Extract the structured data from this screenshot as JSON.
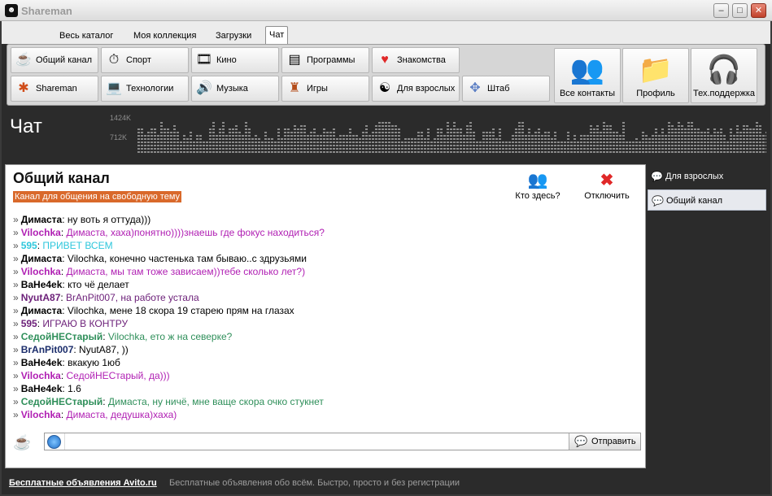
{
  "window": {
    "title": "Shareman",
    "minimize": "–",
    "maximize": "□",
    "close": "✕"
  },
  "tabs": [
    {
      "label": "Весь каталог"
    },
    {
      "label": "Моя коллекция"
    },
    {
      "label": "Загрузки"
    },
    {
      "label": "Чат"
    }
  ],
  "toolbar": {
    "row1": [
      {
        "label": "Общий канал",
        "icon": "cup-icon"
      },
      {
        "label": "Спорт",
        "icon": "stopwatch-icon"
      },
      {
        "label": "Кино",
        "icon": "film-icon"
      },
      {
        "label": "Программы",
        "icon": "programs-icon"
      },
      {
        "label": "Знакомства",
        "icon": "heart-icon"
      }
    ],
    "row2": [
      {
        "label": "Shareman",
        "icon": "shareman-icon"
      },
      {
        "label": "Технологии",
        "icon": "laptop-icon"
      },
      {
        "label": "Музыка",
        "icon": "speaker-icon"
      },
      {
        "label": "Игры",
        "icon": "castle-icon"
      },
      {
        "label": "Для взрослых",
        "icon": "yinyang-icon"
      },
      {
        "label": "Штаб",
        "icon": "compass-icon"
      }
    ],
    "big": [
      {
        "label": "Все контакты",
        "icon": "contacts-icon"
      },
      {
        "label": "Профиль",
        "icon": "profile-folder-icon"
      },
      {
        "label": "Тех.поддержка",
        "icon": "headset-icon"
      }
    ]
  },
  "chat_header": {
    "title": "Чат",
    "scale_top": "1424K",
    "scale_mid": "712K"
  },
  "panel": {
    "title": "Общий канал",
    "subtitle": "Канал для общения на свободную тему",
    "who_here": "Кто здесь?",
    "disconnect": "Отключить"
  },
  "messages": [
    {
      "nick": "Димаста",
      "text": "ну воть я оттуда)))",
      "nick_color": "#000000",
      "text_color": "#000000"
    },
    {
      "nick": "Vilochka",
      "text": "Димаста, хаха)понятно))))знаешь где фокус находиться?",
      "nick_color": "#b01fb3",
      "text_color": "#b01fb3"
    },
    {
      "nick": "595",
      "text": "ПРИВЕТ ВСЕМ",
      "nick_color": "#2ec7dc",
      "text_color": "#2ec7dc"
    },
    {
      "nick": "Димаста",
      "text": "Vilochka, конечно частенька там бываю..с здрузьями",
      "nick_color": "#000000",
      "text_color": "#000000"
    },
    {
      "nick": "Vilochka",
      "text": "Димаста, мы там тоже зависаем))тебе сколько лет?)",
      "nick_color": "#b01fb3",
      "text_color": "#b01fb3"
    },
    {
      "nick": "BaHe4ek",
      "text": "кто чё делает",
      "nick_color": "#000000",
      "text_color": "#000000"
    },
    {
      "nick": "NyutA87",
      "text": "BrAnPit007, на работе устала",
      "nick_color": "#6b1f78",
      "text_color": "#6b1f78"
    },
    {
      "nick": "Димаста",
      "text": "Vilochka, мене 18 скора 19 старею прям на глазах",
      "nick_color": "#000000",
      "text_color": "#000000"
    },
    {
      "nick": "595",
      "text": "ИГРАЮ В КОНТРУ",
      "nick_color": "#6b1f78",
      "text_color": "#6b1f78"
    },
    {
      "nick": "СедойНЕСтарый",
      "text": "Vilochka, ето ж на северке?",
      "nick_color": "#2f8f5a",
      "text_color": "#2f8f5a"
    },
    {
      "nick": "BrAnPit007",
      "text": "NyutA87, ))",
      "nick_color": "#1b2d6b",
      "text_color": "#000000"
    },
    {
      "nick": "BaHe4ek",
      "text": "вкакую 1юб",
      "nick_color": "#000000",
      "text_color": "#000000"
    },
    {
      "nick": "Vilochka",
      "text": "СедойНЕСтарый, да)))",
      "nick_color": "#b01fb3",
      "text_color": "#b01fb3"
    },
    {
      "nick": "BaHe4ek",
      "text": "1.6",
      "nick_color": "#000000",
      "text_color": "#000000"
    },
    {
      "nick": "СедойНЕСтарый",
      "text": "Димаста, ну ничё, мне ваще скора очко стукнет",
      "nick_color": "#2f8f5a",
      "text_color": "#2f8f5a"
    },
    {
      "nick": "Vilochka",
      "text": "Димаста, дедушка)хаха)",
      "nick_color": "#b01fb3",
      "text_color": "#b01fb3"
    }
  ],
  "input": {
    "value": "",
    "send_label": "Отправить"
  },
  "sidebar": [
    {
      "label": "Для взрослых"
    },
    {
      "label": "Общий канал"
    }
  ],
  "footer": {
    "link": "Бесплатные объявления Avito.ru",
    "text": "Бесплатные объявления обо всём. Быстро, просто и без регистрации"
  }
}
